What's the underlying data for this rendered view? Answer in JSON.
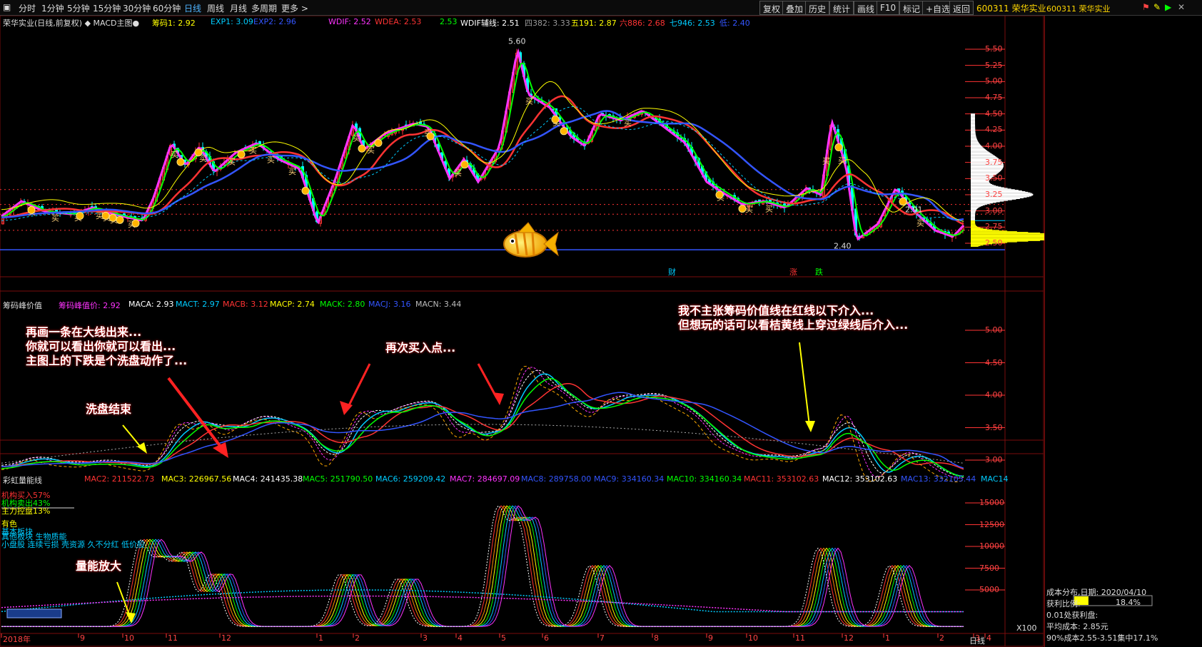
{
  "topbar": {
    "timeframes": [
      "分时",
      "1分钟",
      "5分钟",
      "15分钟",
      "30分钟",
      "60分钟",
      "日线",
      "周线",
      "月线",
      "多周期",
      "更多 >"
    ],
    "active": "日线",
    "buttons": [
      "复权",
      "叠加",
      "历史",
      "统计",
      "画线",
      "F10",
      "标记",
      "+自选",
      "返回"
    ],
    "stock": "600311 荣华实业"
  },
  "main_panel": {
    "title": "荣华实业(日线,前复权) ◆ MACD主图●",
    "indicators": [
      {
        "label": "筹码1: 2.92",
        "color": "#ffff00"
      },
      {
        "label": "EXP1: 3.09",
        "color": "#00ccff"
      },
      {
        "label": "EXP2: 2.96",
        "color": "#3355ff"
      },
      {
        "label": "WDIF: 2.52",
        "color": "#ff33ff"
      },
      {
        "label": "WDEA: 2.53",
        "color": "#ff3333"
      },
      {
        "label": "2.53",
        "color": "#00ff00"
      },
      {
        "label": "WDIF辅线: 2.51",
        "color": "#ffffff"
      },
      {
        "label": "四382: 3.33",
        "color": "#999999"
      },
      {
        "label": "五191: 2.87",
        "color": "#ffff00"
      },
      {
        "label": "六886: 2.68",
        "color": "#ff3333"
      },
      {
        "label": "七946: 2.53",
        "color": "#00ccff"
      },
      {
        "label": "低: 2.40",
        "color": "#3355ff"
      }
    ],
    "y_ticks": [
      "5.50",
      "5.25",
      "5.00",
      "4.75",
      "4.50",
      "4.25",
      "4.00",
      "3.75",
      "3.50",
      "3.25",
      "3.00",
      "2.75",
      "2.50"
    ],
    "high_label": "5.60",
    "low_label": "2.40",
    "last_label": "2.91",
    "buy_mark": "买",
    "event_badges": [
      "财",
      "涨",
      "跌"
    ]
  },
  "panel2": {
    "title": "筹码峰价值",
    "indicators": [
      {
        "label": "筹码峰值价: 2.92",
        "color": "#ff33ff"
      },
      {
        "label": "MACA: 2.93",
        "color": "#ffffff"
      },
      {
        "label": "MACT: 2.97",
        "color": "#00ccff"
      },
      {
        "label": "MACB: 3.12",
        "color": "#ff3333"
      },
      {
        "label": "MACP: 2.74",
        "color": "#ffff00"
      },
      {
        "label": "MACK: 2.80",
        "color": "#00ff00"
      },
      {
        "label": "MACJ: 3.16",
        "color": "#3355ff"
      },
      {
        "label": "MACN: 3.44",
        "color": "#bbbbbb"
      }
    ],
    "y_ticks": [
      "5.00",
      "4.50",
      "4.00",
      "3.50",
      "3.00"
    ]
  },
  "panel3": {
    "title": "彩虹量能线",
    "indicators": [
      {
        "label": "MAC2: 211522.73",
        "color": "#ff3333"
      },
      {
        "label": "MAC3: 226967.56",
        "color": "#ffff00"
      },
      {
        "label": "MAC4: 241435.38",
        "color": "#ffffff"
      },
      {
        "label": "MAC5: 251790.50",
        "color": "#00ff00"
      },
      {
        "label": "MAC6: 259209.42",
        "color": "#00ccff"
      },
      {
        "label": "MAC7: 284697.09",
        "color": "#ff33ff"
      },
      {
        "label": "MAC8: 289758.00",
        "color": "#3355ff"
      },
      {
        "label": "MAC9: 334160.34",
        "color": "#3355ff"
      },
      {
        "label": "MAC10: 334160.34",
        "color": "#00ff00"
      },
      {
        "label": "MAC11: 353102.63",
        "color": "#ff3333"
      },
      {
        "label": "MAC12: 353102.63",
        "color": "#ffffff"
      },
      {
        "label": "MAC13: 332105.44",
        "color": "#3355ff"
      },
      {
        "label": "MAC14",
        "color": "#00ccff"
      }
    ],
    "left_texts": [
      {
        "text": "机构买入57%",
        "color": "#ff3333"
      },
      {
        "text": "机构卖出43%",
        "color": "#00ff00"
      },
      {
        "text": "主力控盘13%",
        "color": "#ffff00"
      }
    ],
    "sector_texts": [
      {
        "text": "有色",
        "color": "#ffff00"
      },
      {
        "text": "基本板块",
        "color": "#00ccff"
      },
      {
        "text": "其他板块 生物质能",
        "color": "#00ccff"
      },
      {
        "text": "小盘股 连续亏损 壳资源 久不分红 低价股",
        "color": "#00ccff"
      }
    ],
    "y_ticks": [
      "15000",
      "12500",
      "10000",
      "7500",
      "5000"
    ],
    "unit": "X100"
  },
  "x_axis": [
    "2018年",
    "9",
    "10",
    "11",
    "12",
    "1",
    "2",
    "3",
    "4",
    "5",
    "6",
    "7",
    "8",
    "9",
    "10",
    "11",
    "12",
    "1",
    "2",
    "3",
    "4"
  ],
  "period": "日线",
  "annotations": {
    "a1": [
      "再画一条在大线出来...",
      "你就可以看出你就可以看出...",
      "主图上的下跌是个洗盘动作了..."
    ],
    "a2": "再次买入点...",
    "a3": [
      "我不主张筹码价值线在红线以下介入...",
      "但想玩的话可以看桔黄线上穿过绿线后介入..."
    ],
    "a4": "洗盘结束",
    "a5": "量能放大"
  },
  "right_panel": {
    "title": "600311 荣华实业",
    "dist_date": "成本分布,日期: 2020/04/10",
    "profit_ratio_label": "获利比例:",
    "profit_ratio": "18.4%",
    "profit_ratio_value": 0.184,
    "line3": "0.01处获利盘:",
    "line4": "平均成本: 2.85元",
    "line5": "90%成本2.55-3.51集中17.1%"
  },
  "colors": {
    "up": "#ff3333",
    "down": "#00ffff",
    "grid": "#7a0d0d",
    "axis": "#ff3333"
  }
}
